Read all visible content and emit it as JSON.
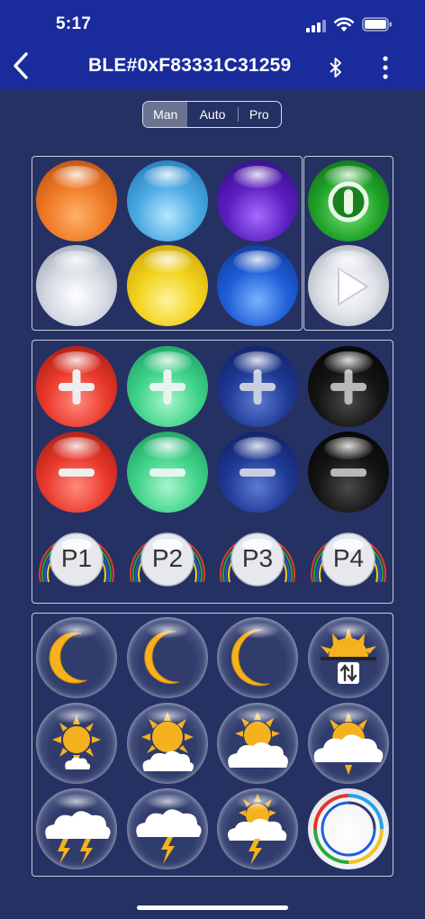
{
  "status_bar": {
    "time": "5:17"
  },
  "nav": {
    "title": "BLE#0xF83331C31259"
  },
  "mode_tabs": [
    {
      "label": "Man"
    },
    {
      "label": "Auto"
    },
    {
      "label": "Pro"
    }
  ],
  "mode_selected": "Man",
  "colors": {
    "background": "#253163",
    "top_bar": "#1a2b9c",
    "orange": "#ee7a25",
    "cyan": "#49a9e2",
    "purple": "#5a1ec0",
    "yellow": "#f2d21c",
    "blue": "#1f5fd8",
    "power_green": "#20a228",
    "red": "#e9392c",
    "green": "#3fd38a",
    "navy": "#1f3a95",
    "black": "#0c0c0c",
    "moon_sun": "#f5b21e"
  },
  "presets": [
    {
      "label": "P1"
    },
    {
      "label": "P2"
    },
    {
      "label": "P3"
    },
    {
      "label": "P4"
    }
  ],
  "weather_icons": [
    "crescent-moon-icon",
    "crescent-moon-icon",
    "crescent-moon-icon",
    "sunrise-sunset-icon",
    "sun-small-cloud-icon",
    "sun-behind-cloud-icon",
    "cloud-sun-peek-icon",
    "sun-behind-large-cloud-icon",
    "thunderstorm-icon",
    "cloud-lightning-icon",
    "sun-cloud-lightning-icon",
    "color-cycle-icon"
  ]
}
